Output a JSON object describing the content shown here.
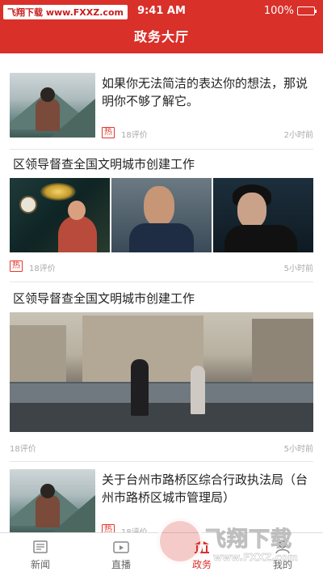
{
  "status_bar": {
    "watermark_text": "飞翔下载 www.FXXZ.com",
    "time": "9:41 AM",
    "battery": "100%"
  },
  "nav": {
    "title": "政务大厅"
  },
  "articles": [
    {
      "title": "如果你无法简洁的表达你的想法，那说明你不够了解它。",
      "tag": "热",
      "comments": "18评价",
      "time": "2小时前"
    },
    {
      "title": "区领导督查全国文明城市创建工作",
      "tag": "热",
      "comments": "18评价",
      "time": "5小时前"
    },
    {
      "title": "区领导督查全国文明城市创建工作",
      "comments": "18评价",
      "time": "5小时前"
    },
    {
      "title": "关于台州市路桥区综合行政执法局（台州市路桥区城市管理局）",
      "tag": "热",
      "comments": "18评价"
    }
  ],
  "tabs": [
    {
      "label": "新闻",
      "icon": "news-icon"
    },
    {
      "label": "直播",
      "icon": "live-icon"
    },
    {
      "label": "政务",
      "icon": "government-icon",
      "active": true
    },
    {
      "label": "我的",
      "icon": "profile-icon"
    }
  ],
  "watermark": {
    "brand": "飞翔下载",
    "url": "www.FXXZ.com"
  },
  "colors": {
    "brand_red": "#d9302a",
    "hot_tag": "#e2382f",
    "meta_gray": "#aaaaaa"
  }
}
